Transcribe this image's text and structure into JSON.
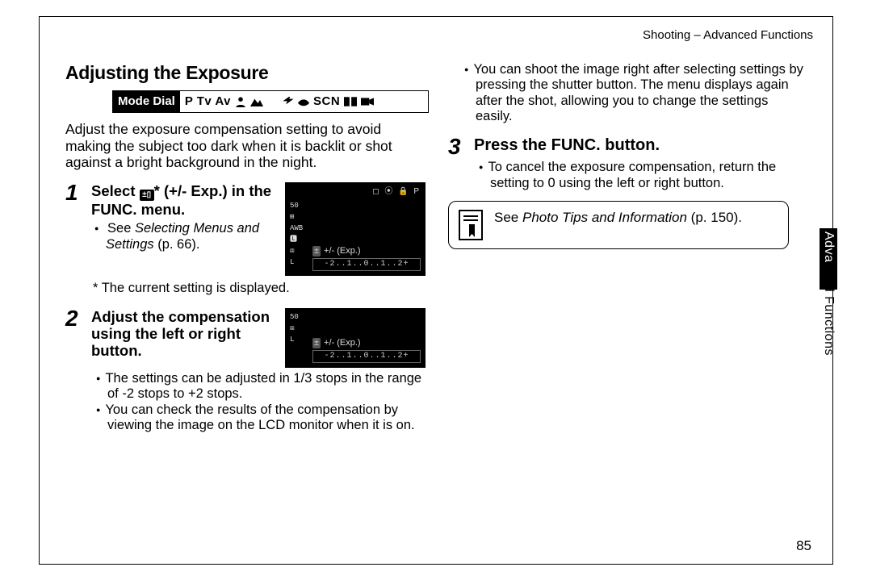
{
  "header": "Shooting – Advanced Functions",
  "page_number": "85",
  "side_tab": {
    "white": "Adva",
    "black": "nced Functions"
  },
  "section_title": "Adjusting the Exposure",
  "mode_dial": {
    "label": "Mode Dial",
    "modes": "P Tv Av",
    "scn": "SCN"
  },
  "intro": "Adjust the exposure compensation setting to avoid making the subject too dark when it is backlit or shot against a bright background in the night.",
  "step1": {
    "num": "1",
    "title_a": "Select ",
    "title_b": "* (+/- Exp.) in the FUNC. menu.",
    "bullet_prefix": "See ",
    "bullet_italic": "Selecting Menus and Settings",
    "bullet_suffix": " (p. 66).",
    "footnote": "* The current setting is displayed."
  },
  "step2": {
    "num": "2",
    "title": "Adjust the compensation using the left or right button.",
    "bullets": [
      "The settings can be adjusted in 1/3 stops in the range of -2 stops to +2 stops.",
      "You can check the results of the compensation by viewing the image on the LCD monitor when it is on."
    ]
  },
  "col2_first_bullet": "You can shoot the image right after selecting settings by pressing the shutter button. The menu displays again after the shot, allowing you to change the settings easily.",
  "step3": {
    "num": "3",
    "title": "Press the FUNC. button.",
    "bullet": "To cancel the exposure compensation, return the setting to 0 using the left or right button."
  },
  "info_box": {
    "prefix": "See ",
    "italic": "Photo Tips and Information",
    "suffix": " (p. 150)."
  },
  "lcd": {
    "top": "◻ ⦿ 🔒 P",
    "exp_label": "+/- (Exp.)",
    "scale": "-2..1..0..1..2+",
    "left": "50\n⊞\nAWB\n🅻\n⧈\nL"
  }
}
